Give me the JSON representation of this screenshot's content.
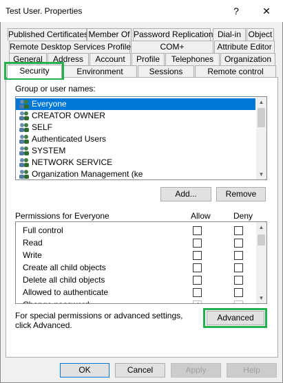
{
  "window": {
    "title": "Test User. Properties",
    "help_glyph": "?",
    "close_glyph": "✕"
  },
  "tabs": {
    "row1": [
      "Published Certificates",
      "Member Of",
      "Password Replication",
      "Dial-in",
      "Object"
    ],
    "row2": [
      "Remote Desktop Services Profile",
      "COM+",
      "Attribute Editor"
    ],
    "row3": [
      "General",
      "Address",
      "Account",
      "Profile",
      "Telephones",
      "Organization"
    ],
    "row4": [
      "Security",
      "Environment",
      "Sessions",
      "Remote control"
    ],
    "active": "Security"
  },
  "group_section": {
    "label": "Group or user names:",
    "items": [
      "Everyone",
      "CREATOR OWNER",
      "SELF",
      "Authenticated Users",
      "SYSTEM",
      "NETWORK SERVICE",
      "Organization Management (ke"
    ],
    "selected_index": 0,
    "add_label": "Add...",
    "remove_label": "Remove"
  },
  "permissions": {
    "header": "Permissions for Everyone",
    "allow_label": "Allow",
    "deny_label": "Deny",
    "items": [
      "Full control",
      "Read",
      "Write",
      "Create all child objects",
      "Delete all child objects",
      "Allowed to authenticate",
      "Change password"
    ]
  },
  "special": {
    "text": "For special permissions or advanced settings, click Advanced.",
    "advanced_label": "Advanced"
  },
  "footer": {
    "ok": "OK",
    "cancel": "Cancel",
    "apply": "Apply",
    "help": "Help"
  },
  "arrows": {
    "up": "▲",
    "down": "▼"
  },
  "colors": {
    "selection": "#0078d7",
    "highlight_box": "#22b14c",
    "background": "#f0f0f0"
  },
  "icons": {
    "group": "users-group-icon"
  }
}
